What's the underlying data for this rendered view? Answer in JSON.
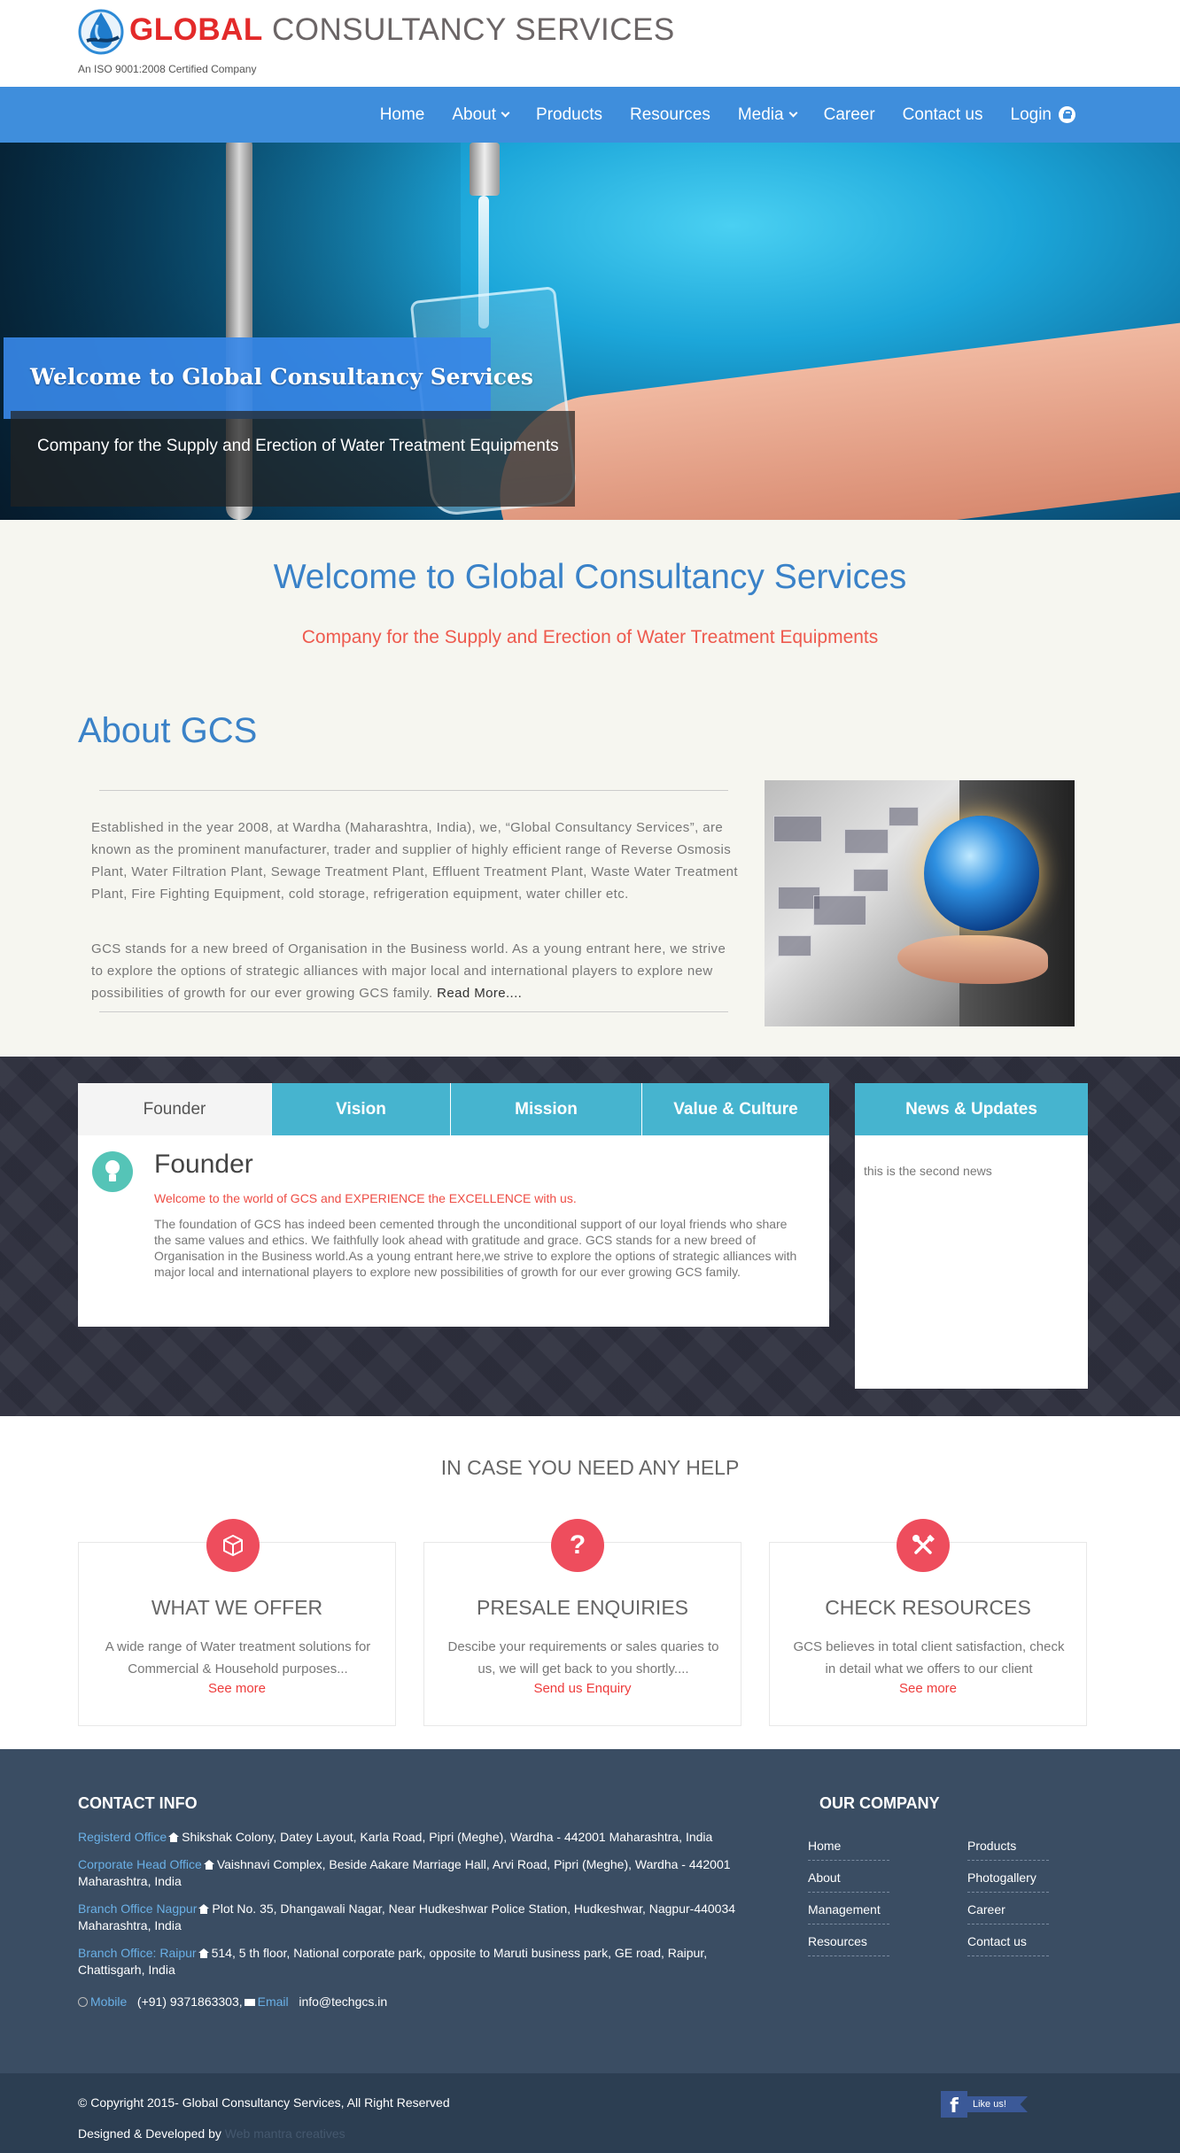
{
  "header": {
    "logo_word1": "GLOBAL",
    "logo_word2": "CONSULTANCY SERVICES",
    "tagline": "An ISO 9001:2008 Certified Company"
  },
  "nav": {
    "items": [
      {
        "label": "Home"
      },
      {
        "label": "About",
        "dropdown": true
      },
      {
        "label": "Products"
      },
      {
        "label": "Resources"
      },
      {
        "label": "Media",
        "dropdown": true
      },
      {
        "label": "Career"
      },
      {
        "label": "Contact us"
      },
      {
        "label": "Login",
        "icon": "lock-icon"
      }
    ]
  },
  "hero": {
    "title": "Welcome to Global Consultancy Services",
    "subtitle": "Company for the Supply and Erection of Water Treatment Equipments"
  },
  "welcome": {
    "title": "Welcome to Global Consultancy Services",
    "subtitle": "Company for the Supply and Erection of Water Treatment Equipments"
  },
  "about": {
    "title": "About GCS",
    "paragraph1": "Established in the year 2008, at Wardha (Maharashtra, India), we, “Global Consultancy Services”, are known as the prominent manufacturer, trader and supplier of highly efficient range of Reverse Osmosis Plant, Water Filtration Plant, Sewage Treatment Plant, Effluent Treatment Plant, Waste Water Treatment Plant, Fire Fighting Equipment, cold storage, refrigeration equipment, water chiller etc.",
    "paragraph2": "GCS stands for a new breed of Organisation in the Business world. As a young entrant here, we strive to explore the options of strategic alliances with major local and international players to explore new possibilities of growth for our ever growing GCS family.",
    "read_more": "Read More...."
  },
  "tabs": {
    "items": [
      {
        "label": "Founder",
        "active": true
      },
      {
        "label": "Vision"
      },
      {
        "label": "Mission"
      },
      {
        "label": "Value & Culture"
      }
    ],
    "panel": {
      "icon": "bulb-icon",
      "title": "Founder",
      "accent": "Welcome to the world of GCS and EXPERIENCE the EXCELLENCE with us.",
      "body": "The foundation of GCS has indeed been cemented through the unconditional support of our loyal friends who share the same values and ethics. We faithfully look ahead with gratitude and grace. GCS stands for a new breed of Organisation in the Business world.As a young entrant here,we strive to explore the options of strategic alliances with major local and international players to explore new possibilities of growth for our ever growing GCS family."
    }
  },
  "news": {
    "title": "News & Updates",
    "items": [
      "this is the second news"
    ]
  },
  "help": {
    "title": "IN CASE YOU NEED ANY HELP",
    "cards": [
      {
        "icon": "box-icon",
        "title": "WHAT WE OFFER",
        "text": "A wide range of Water treatment solutions for Commercial & Household purposes...",
        "link": "See more"
      },
      {
        "icon": "question-icon",
        "title": "PRESALE ENQUIRIES",
        "text": "Descibe your requirements or sales quaries to us, we will get back to you shortly....",
        "link": "Send us Enquiry"
      },
      {
        "icon": "tools-icon",
        "title": "CHECK RESOURCES",
        "text": "GCS believes in total client satisfaction, check in detail what we offers to our client",
        "link": "See more"
      }
    ]
  },
  "footer": {
    "contact_title": "CONTACT INFO",
    "contacts": [
      {
        "label": "Registerd Office",
        "text": "Shikshak Colony, Datey Layout, Karla Road, Pipri (Meghe), Wardha - 442001 Maharashtra, India"
      },
      {
        "label": "Corporate Head Office",
        "text": "Vaishnavi Complex, Beside Aakare Marriage Hall, Arvi Road, Pipri (Meghe), Wardha - 442001 Maharashtra, India"
      },
      {
        "label": "Branch Office Nagpur",
        "text": "Plot No. 35, Dhangawali Nagar, Near Hudkeshwar Police Station, Hudkeshwar, Nagpur-440034 Maharashtra, India"
      },
      {
        "label": "Branch Office: Raipur",
        "text": "514, 5 th floor, National corporate park, opposite to Maruti business park, GE road, Raipur, Chattisgarh, India"
      }
    ],
    "mobile_label": "Mobile",
    "mobile": "(+91) 9371863303,",
    "email_label": "Email",
    "email": "info@techgcs.in",
    "company_title": "OUR COMPANY",
    "company_links": [
      "Home",
      "Products",
      "About",
      "Photogallery",
      "Management",
      "Career",
      "Resources",
      "Contact us"
    ],
    "copyright": "© Copyright 2015- Global Consultancy Services, All Right Reserved",
    "designed_prefix": "Designed & Developed by",
    "designed_by": "Web mantra creatives",
    "fb_like": "Like us!"
  },
  "colors": {
    "nav_blue": "#3f8edc",
    "tab_teal": "#46b4cf",
    "accent_red": "#ee4d5d",
    "footer_bg": "#3a4d63"
  }
}
